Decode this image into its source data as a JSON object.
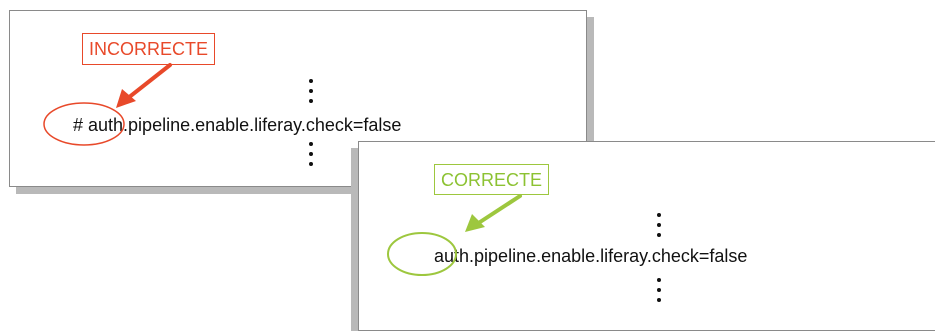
{
  "incorrect_example": {
    "label": "INCORRECTE",
    "code_line": "# auth.pipeline.enable.liferay.check=false",
    "label_color": "#e8492a"
  },
  "correct_example": {
    "label": "CORRECTE",
    "code_line": "auth.pipeline.enable.liferay.check=false",
    "label_color": "#9dc73e"
  }
}
